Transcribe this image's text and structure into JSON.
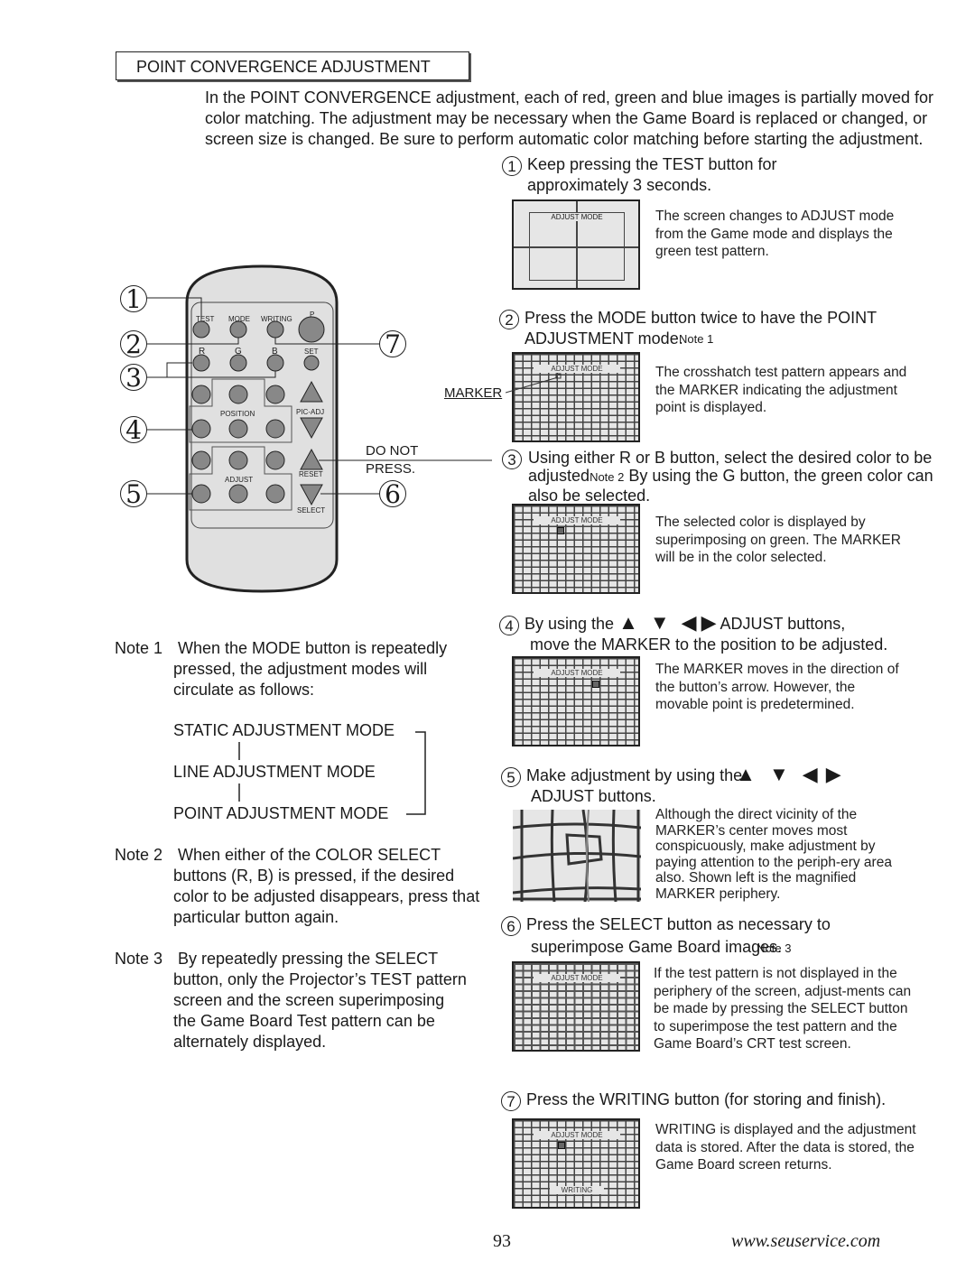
{
  "page": {
    "title": "POINT CONVERGENCE ADJUSTMENT",
    "intro": "In the POINT CONVERGENCE adjustment, each of red, green and blue images is partially moved for color matching.  The adjustment may be necessary when the Game Board is replaced or changed, or screen size is changed.  Be sure to perform automatic color matching before starting the adjustment.",
    "page_number": "93",
    "website": "www.seuservice.com"
  },
  "remote": {
    "callouts": [
      "1",
      "2",
      "3",
      "4",
      "5",
      "6",
      "7"
    ],
    "buttons": {
      "test": "TEST",
      "mode": "MODE",
      "writing": "WRITING",
      "p": "P",
      "r": "R",
      "g": "G",
      "b": "B",
      "set": "SET",
      "position": "POSITION",
      "pic_adj": "PIC-ADJ",
      "adjust": "ADJUST",
      "reset": "RESET",
      "select": "SELECT"
    },
    "do_not_press": [
      "DO NOT",
      "PRESS."
    ],
    "marker_label": "MARKER"
  },
  "steps": [
    {
      "num": "1",
      "heading": "Keep pressing the TEST button for approximately 3 seconds.",
      "description": "The screen changes to ADJUST mode from the Game mode and displays the green test pattern.",
      "screen_text": "ADJUST MODE"
    },
    {
      "num": "2",
      "heading": "Press the MODE button twice to have the POINT ADJUSTMENT mode.",
      "note_ref": "Note 1",
      "description": "The crosshatch test pattern appears and the MARKER indicating the adjustment point is displayed.",
      "screen_text": "ADJUST MODE"
    },
    {
      "num": "3",
      "heading_a": "Using either R or B button, select the desired color to be adjusted",
      "note_ref": "Note 2",
      "heading_b": " By using the G button, the green color can also be selected.",
      "description": "The selected color is displayed by superimposing on green.  The MARKER will be in the color selected.",
      "screen_text": "ADJUST MODE"
    },
    {
      "num": "4",
      "heading_a": "By using the",
      "arrows": [
        "▲",
        "▼",
        "◀",
        "▶"
      ],
      "heading_b": "ADJUST buttons,",
      "heading_c": "move the MARKER to the position to be adjusted.",
      "description": "The MARKER moves in the direction of the button’s arrow. However, the movable point is predetermined.",
      "screen_text": "ADJUST MODE"
    },
    {
      "num": "5",
      "heading_a": "Make adjustment by using the",
      "arrows": [
        "▲",
        "▼",
        "◀",
        "▶"
      ],
      "heading_b": "ADJUST buttons.",
      "description": "Although the direct vicinity of the MARKER’s center moves most conspicuously, make adjustment by paying attention to the periph-ery area also.  Shown left is the magnified MARKER periphery."
    },
    {
      "num": "6",
      "heading_a": "Press the SELECT button as necessary to",
      "heading_b": "superimpose Game Board images.",
      "note_ref": "Note 3",
      "description": "If the test pattern is not displayed in the periphery of the screen, adjust-ments can be made by pressing the SELECT button to superimpose the test pattern and the Game Board’s CRT test screen.",
      "screen_text": "ADJUST MODE"
    },
    {
      "num": "7",
      "heading": "Press the WRITING button (for storing and finish).",
      "description": "WRITING is displayed and the adjustment data is stored.  After the data is stored, the Game Board screen returns.",
      "screen_text": "ADJUST MODE",
      "screen_bottom_text": "WRITING"
    }
  ],
  "notes": [
    {
      "label": "Note 1",
      "text": "When the MODE button is repeatedly pressed, the adjustment modes will circulate as follows:",
      "modes": [
        "STATIC ADJUSTMENT MODE",
        "LINE ADJUSTMENT MODE",
        "POINT ADJUSTMENT MODE"
      ]
    },
    {
      "label": "Note 2",
      "text": "When either of the COLOR SELECT buttons (R, B) is pressed, if the desired color to be adjusted disappears, press that particular button again."
    },
    {
      "label": "Note 3",
      "text": "By repeatedly pressing the SELECT button, only the Projector’s TEST pattern screen and the screen superimposing the Game Board Test pattern can be alternately displayed."
    }
  ]
}
